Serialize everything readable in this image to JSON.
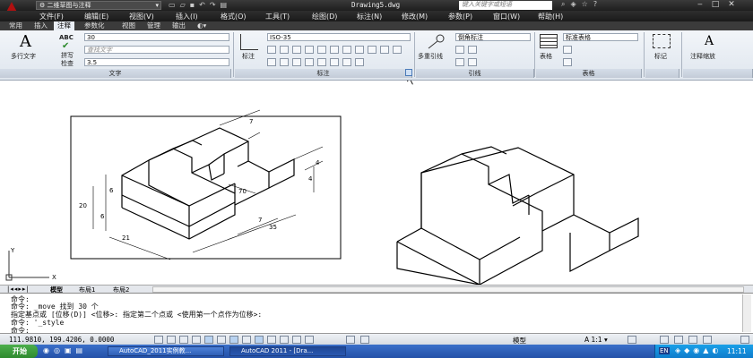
{
  "title_bar": {
    "workspace": "二维草图与注释",
    "filename": "Drawing5.dwg",
    "search_placeholder": "键入关键字或短语"
  },
  "menu": [
    "文件(F)",
    "编辑(E)",
    "视图(V)",
    "插入(I)",
    "格式(O)",
    "工具(T)",
    "绘图(D)",
    "标注(N)",
    "修改(M)",
    "参数(P)",
    "窗口(W)",
    "帮助(H)"
  ],
  "tabs": [
    "常用",
    "插入",
    "注释",
    "参数化",
    "视图",
    "管理",
    "输出"
  ],
  "active_tab": "注释",
  "ribbon": {
    "text_panel": {
      "title": "文字",
      "mtext": "多行文字",
      "spell": "拼写检查",
      "abc": "ABC",
      "style": "30",
      "find_placeholder": "查找文字",
      "height": "3.5"
    },
    "dim_panel": {
      "title": "标注",
      "dimension": "标注",
      "dim_style": "ISO-35"
    },
    "leader_panel": {
      "title": "引线",
      "multileader": "多重引线",
      "leader_style": "倒角标注"
    },
    "table_panel": {
      "title": "表格",
      "table": "表格",
      "table_style": "标准表格"
    },
    "markup": "标记",
    "anno_scale": "注释缩放"
  },
  "drawing": {
    "dims": [
      "7",
      "4",
      "6",
      "20",
      "6",
      "21",
      "70",
      "7",
      "35",
      "4"
    ]
  },
  "layout_tabs": [
    "模型",
    "布局1",
    "布局2"
  ],
  "command_lines": [
    "命令:",
    "命令: _move 找到 30 个",
    "指定基点或 [位移(D)] <位移>:  指定第二个点或 <使用第一个点作为位移>:",
    "命令: '_style",
    "命令:"
  ],
  "status": {
    "coords": "111.9810, 199.4206, 0.0000",
    "model": "模型",
    "scale": "1:1"
  },
  "taskbar": {
    "start": "开始",
    "items": [
      "AutoCAD_2011实例教...",
      "AutoCAD 2011 - [Dra..."
    ],
    "lang": "EN",
    "time": "11:11"
  }
}
